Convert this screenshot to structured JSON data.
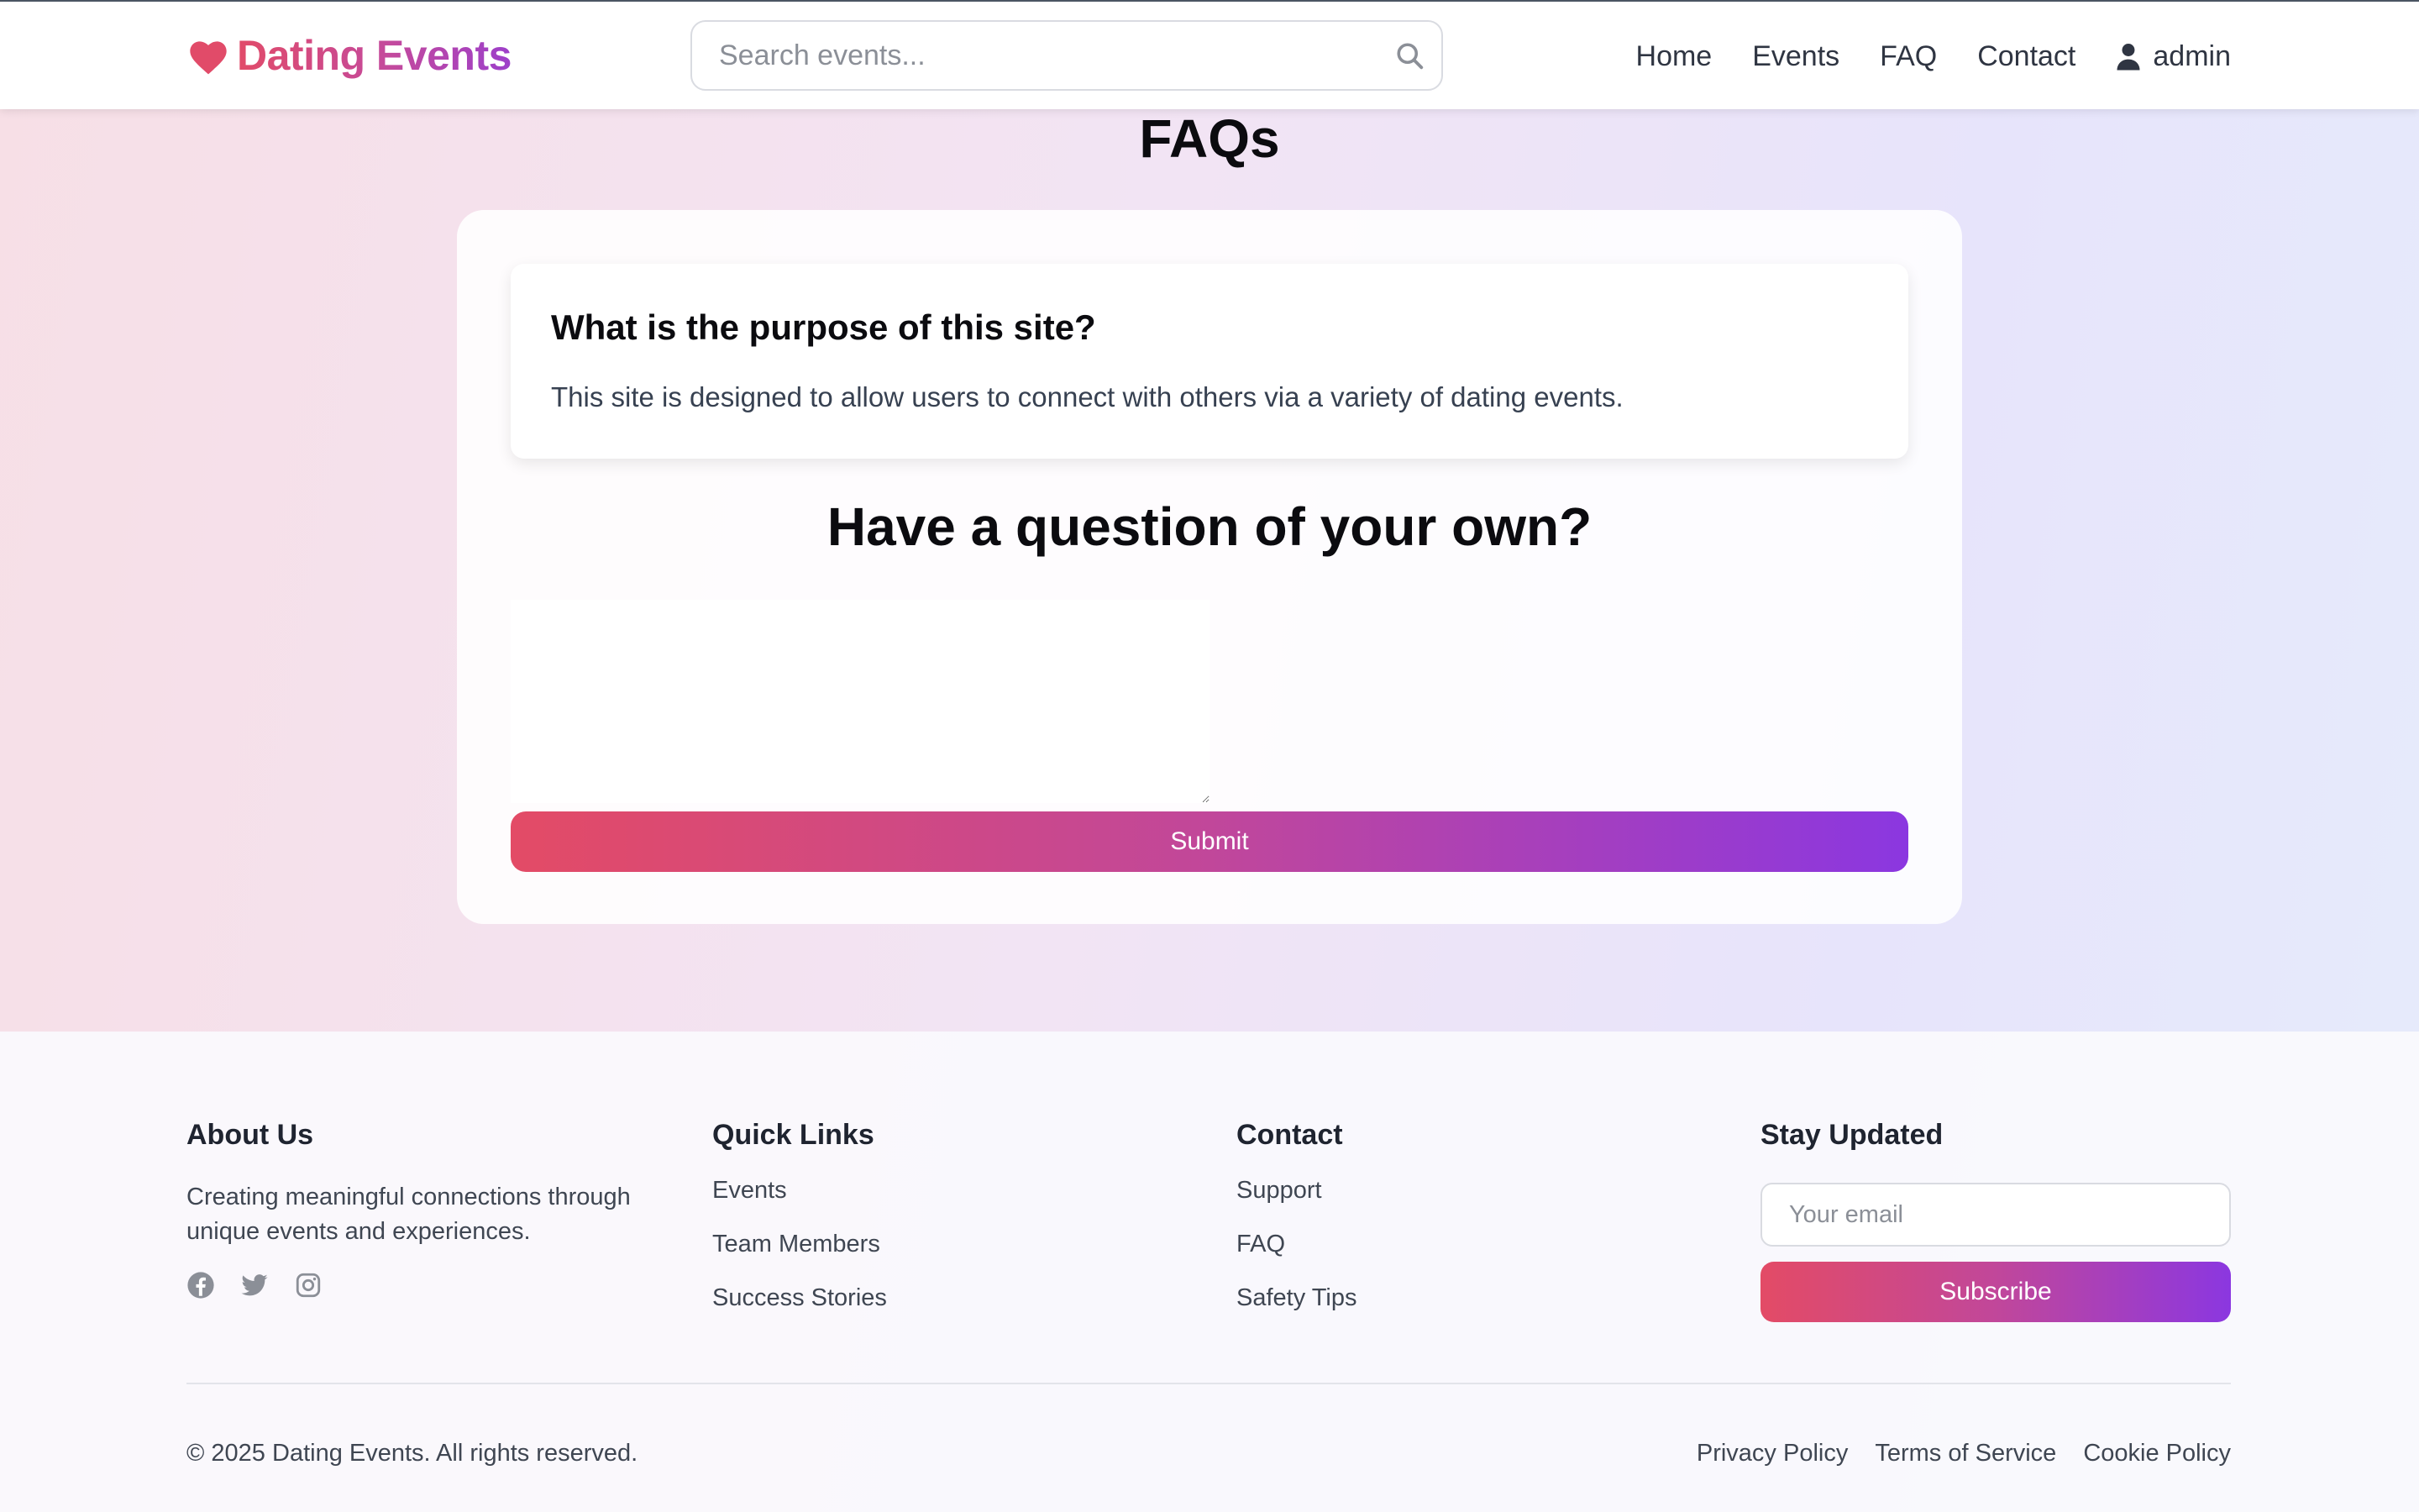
{
  "header": {
    "brand": "Dating Events",
    "search_placeholder": "Search events...",
    "nav": [
      "Home",
      "Events",
      "FAQ",
      "Contact"
    ],
    "user": "admin"
  },
  "main": {
    "title": "FAQs",
    "faqs": [
      {
        "question": "What is the purpose of this site?",
        "answer": "This site is designed to allow users to connect with others via a variety of dating events."
      }
    ],
    "ask_heading": "Have a question of your own?",
    "question_value": "",
    "submit_label": "Submit"
  },
  "footer": {
    "about": {
      "heading": "About Us",
      "text": "Creating meaningful connections through unique events and experiences.",
      "social_icons": [
        "facebook-icon",
        "twitter-icon",
        "instagram-icon"
      ]
    },
    "quick_links": {
      "heading": "Quick Links",
      "items": [
        "Events",
        "Team Members",
        "Success Stories"
      ]
    },
    "contact": {
      "heading": "Contact",
      "items": [
        "Support",
        "FAQ",
        "Safety Tips"
      ]
    },
    "newsletter": {
      "heading": "Stay Updated",
      "email_placeholder": "Your email",
      "subscribe_label": "Subscribe"
    },
    "copyright": "© 2025 Dating Events. All rights reserved.",
    "legal": [
      "Privacy Policy",
      "Terms of Service",
      "Cookie Policy"
    ]
  },
  "colors": {
    "brand_start": "#e14b69",
    "brand_end": "#9d3fca",
    "button_gradient_start": "#e34b66",
    "button_gradient_end": "#8b37e0"
  }
}
